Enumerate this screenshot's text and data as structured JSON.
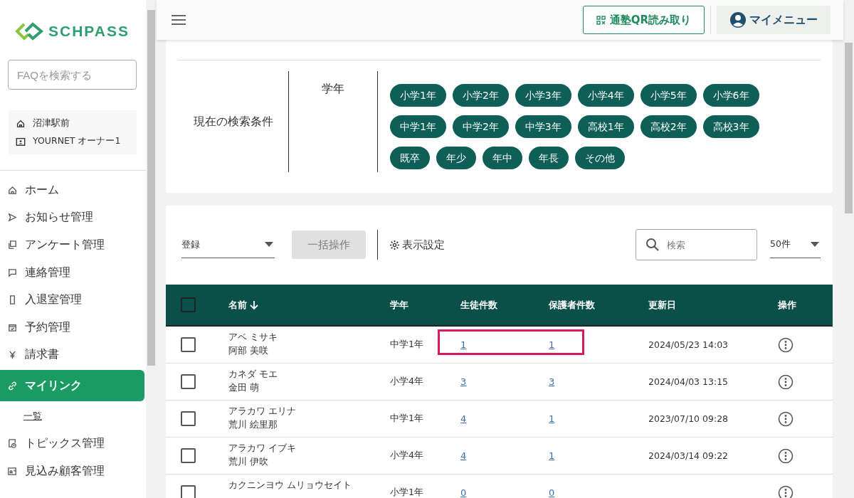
{
  "logo": {
    "text": "SCHPASS"
  },
  "faq_search": {
    "placeholder": "FAQを検索する"
  },
  "account": {
    "school": "沼津駅前",
    "user": "YOURNET オーナー1"
  },
  "sidebar": {
    "items": [
      {
        "kind": "home",
        "label": "ホーム",
        "selected": false
      },
      {
        "kind": "send",
        "label": "お知らせ管理",
        "selected": false
      },
      {
        "kind": "survey",
        "label": "アンケート管理",
        "selected": false
      },
      {
        "kind": "chat",
        "label": "連絡管理",
        "selected": false
      },
      {
        "kind": "door",
        "label": "入退室管理",
        "selected": false
      },
      {
        "kind": "calendar",
        "label": "予約管理",
        "selected": false
      },
      {
        "kind": "yen",
        "label": "請求書",
        "selected": false
      },
      {
        "kind": "link",
        "label": "マイリンク",
        "selected": true,
        "children": [
          {
            "label": "一覧"
          }
        ]
      },
      {
        "kind": "topics",
        "label": "トピックス管理",
        "selected": false
      },
      {
        "kind": "prospect",
        "label": "見込み顧客管理",
        "selected": false
      }
    ]
  },
  "header": {
    "qr_button": "通塾QR読み取り",
    "my_menu": "マイメニュー"
  },
  "conditions": {
    "title": "現在の検索条件",
    "field": "学年",
    "chips": [
      [
        "小学1年",
        "小学2年",
        "小学3年",
        "小学4年",
        "小学5年",
        "小学6年"
      ],
      [
        "中学1年",
        "中学2年",
        "中学3年",
        "高校1年",
        "高校2年",
        "高校3年"
      ],
      [
        "既卒",
        "年少",
        "年中",
        "年長",
        "その他"
      ]
    ]
  },
  "toolbar": {
    "sort_select": "登録",
    "bulk_button": "一括操作",
    "bulk_disabled": true,
    "display_settings": "表示設定",
    "search": {
      "placeholder": "検索"
    },
    "page_size": "50件"
  },
  "table": {
    "select_all_checked": false,
    "columns": [
      "名前",
      "学年",
      "生徒件数",
      "保護者件数",
      "更新日",
      "操作"
    ],
    "rows": [
      {
        "kana": "アベ ミサキ",
        "name": "阿部 美咲",
        "grade": "中学1年",
        "students": "1",
        "guardians": "1",
        "updated": "2024/05/23 14:03",
        "checked": false,
        "highlighted": true
      },
      {
        "kana": "カネダ モエ",
        "name": "金田 萌",
        "grade": "小学4年",
        "students": "3",
        "guardians": "3",
        "updated": "2024/04/03 13:15",
        "checked": false,
        "highlighted": false
      },
      {
        "kana": "アラカワ エリナ",
        "name": "荒川 絵里那",
        "grade": "中学1年",
        "students": "4",
        "guardians": "1",
        "updated": "2023/07/10 09:28",
        "checked": false,
        "highlighted": false
      },
      {
        "kana": "アラカワ イブキ",
        "name": "荒川 伊吹",
        "grade": "小学4年",
        "students": "4",
        "guardians": "1",
        "updated": "2024/03/14 09:22",
        "checked": false,
        "highlighted": false
      },
      {
        "kana": "カクニンヨウ ムリョウセイト",
        "grade": "小学1年",
        "students": "0",
        "guardians": "0",
        "checked": false,
        "highlighted": false
      }
    ]
  }
}
